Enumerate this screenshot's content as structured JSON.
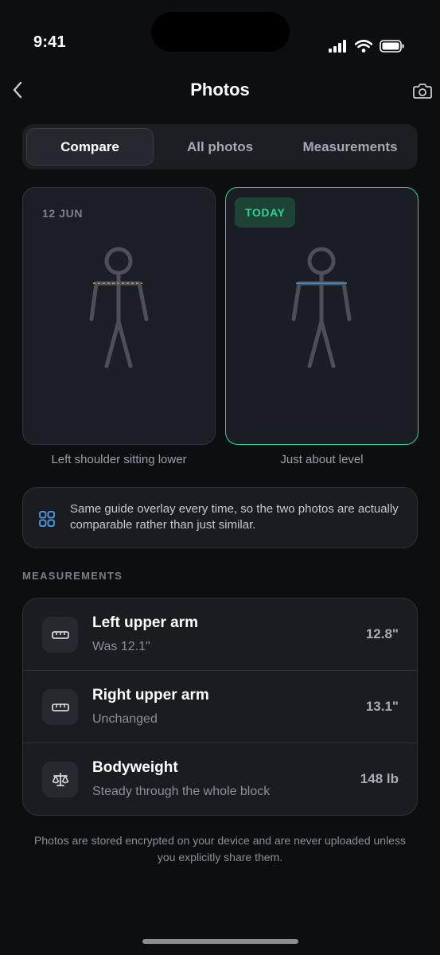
{
  "status_bar": {
    "time": "9:41"
  },
  "nav": {
    "title": "Photos"
  },
  "tabs": [
    {
      "label": "Compare",
      "active": true
    },
    {
      "label": "All photos",
      "active": false
    },
    {
      "label": "Measurements",
      "active": false
    }
  ],
  "photos": {
    "before": {
      "date": "12 JUN",
      "caption": "Left shoulder sitting lower"
    },
    "after": {
      "badge": "TODAY",
      "caption": "Just about level"
    }
  },
  "note": {
    "text": "Same guide overlay every time, so the two photos are actually comparable rather than just similar."
  },
  "measurements": {
    "section_label": "MEASUREMENTS",
    "items": [
      {
        "title": "Left upper arm",
        "subtitle": "Was 12.1\"",
        "value": "12.8\"",
        "icon": "ruler-icon"
      },
      {
        "title": "Right upper arm",
        "subtitle": "Unchanged",
        "value": "13.1\"",
        "icon": "ruler-icon"
      },
      {
        "title": "Bodyweight",
        "subtitle": "Steady through the whole block",
        "value": "148 lb",
        "icon": "scale-icon"
      }
    ]
  },
  "footnote": "Photos are stored encrypted on your device and are never uploaded unless you explicitly share them.",
  "colors": {
    "accent": "#2fd494",
    "background": "#0d0e11",
    "card": "#1a1c22",
    "guide_line_before": "#c08a3e",
    "guide_line_after": "#4a86b8"
  }
}
